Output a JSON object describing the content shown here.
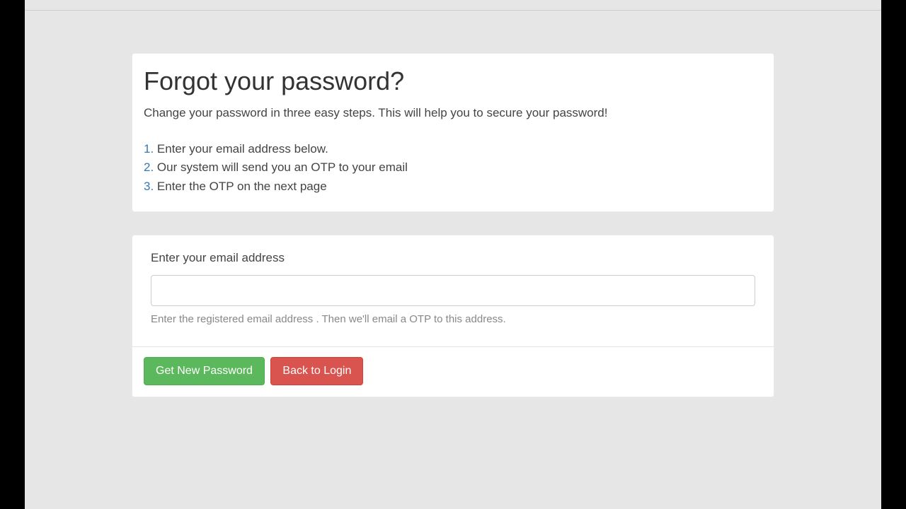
{
  "header": {
    "title": "Forgot your password?",
    "subtitle": "Change your password in three easy steps. This will help you to secure your password!",
    "steps": [
      {
        "num": "1.",
        "text": " Enter your email address below."
      },
      {
        "num": "2.",
        "text": " Our system will send you an OTP to your email"
      },
      {
        "num": "3.",
        "text": " Enter the OTP on the next page"
      }
    ]
  },
  "form": {
    "email_label": "Enter your email address",
    "email_value": "",
    "email_help": "Enter the registered email address . Then we'll email a OTP to this address."
  },
  "buttons": {
    "submit": "Get New Password",
    "back": "Back to Login"
  }
}
